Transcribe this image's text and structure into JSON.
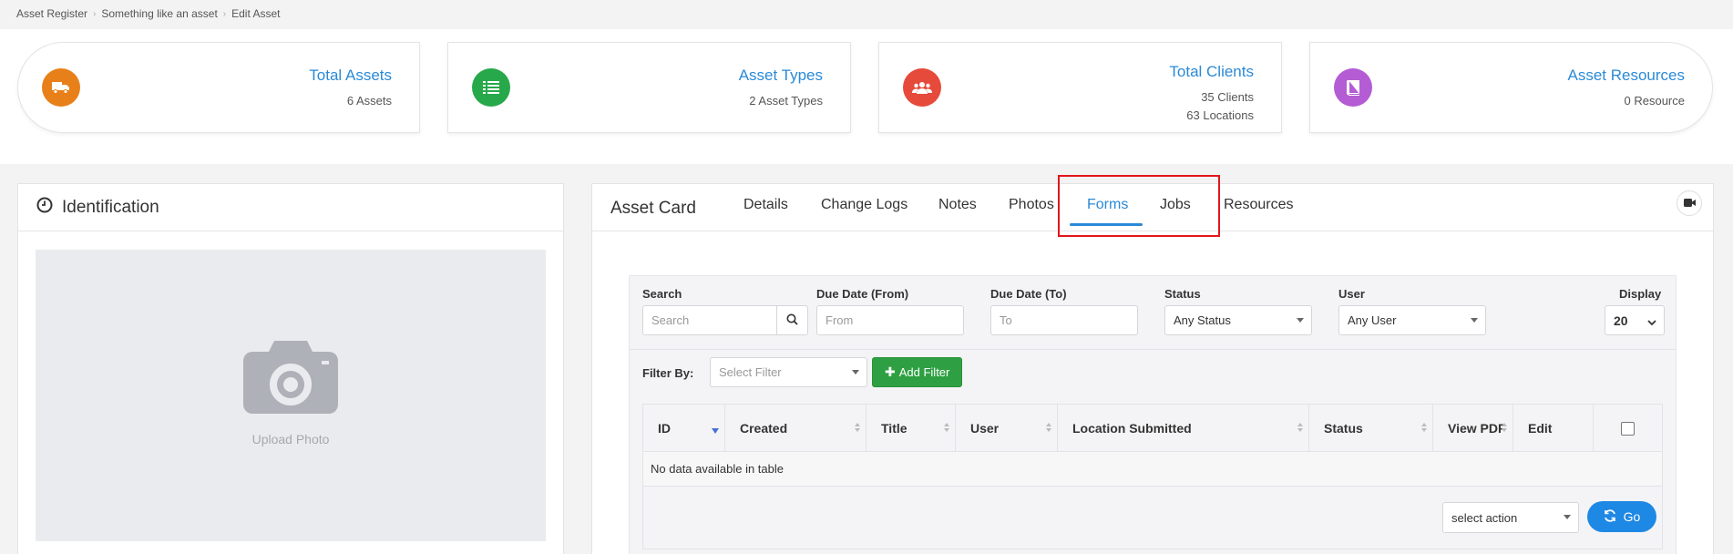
{
  "breadcrumb": [
    "Asset Register",
    "Something like an asset",
    "Edit Asset"
  ],
  "stats": [
    {
      "title": "Total Assets",
      "sub1": "6 Assets",
      "sub2": "",
      "color": "#e8801a",
      "icon": "truck-icon"
    },
    {
      "title": "Asset Types",
      "sub1": "2 Asset Types",
      "sub2": "",
      "color": "#27a84a",
      "icon": "list-icon"
    },
    {
      "title": "Total Clients",
      "sub1": "35 Clients",
      "sub2": "63 Locations",
      "color": "#e64a3b",
      "icon": "users-icon"
    },
    {
      "title": "Asset Resources",
      "sub1": "0 Resource",
      "sub2": "",
      "color": "#b45cd4",
      "icon": "book-icon"
    }
  ],
  "identification": {
    "title": "Identification",
    "upload_label": "Upload Photo"
  },
  "asset_card": {
    "title": "Asset Card",
    "tabs": [
      {
        "label": "Details"
      },
      {
        "label": "Change Logs"
      },
      {
        "label": "Notes"
      },
      {
        "label": "Photos"
      },
      {
        "label": "Forms",
        "active": true
      },
      {
        "label": "Jobs"
      },
      {
        "label": "Resources"
      }
    ]
  },
  "filters": {
    "search_label": "Search",
    "search_placeholder": "Search",
    "due_from_label": "Due Date (From)",
    "due_from_placeholder": "From",
    "due_to_label": "Due Date (To)",
    "due_to_placeholder": "To",
    "status_label": "Status",
    "status_value": "Any Status",
    "user_label": "User",
    "user_value": "Any User",
    "display_label": "Display",
    "display_value": "20",
    "filter_by_label": "Filter By:",
    "filter_select_placeholder": "Select Filter",
    "add_filter_label": "Add Filter"
  },
  "table": {
    "columns": [
      "ID",
      "Created",
      "Title",
      "User",
      "Location Submitted",
      "Status",
      "View PDF",
      "Edit"
    ],
    "empty_text": "No data available in table",
    "action_select": "select action",
    "go_label": "Go"
  }
}
